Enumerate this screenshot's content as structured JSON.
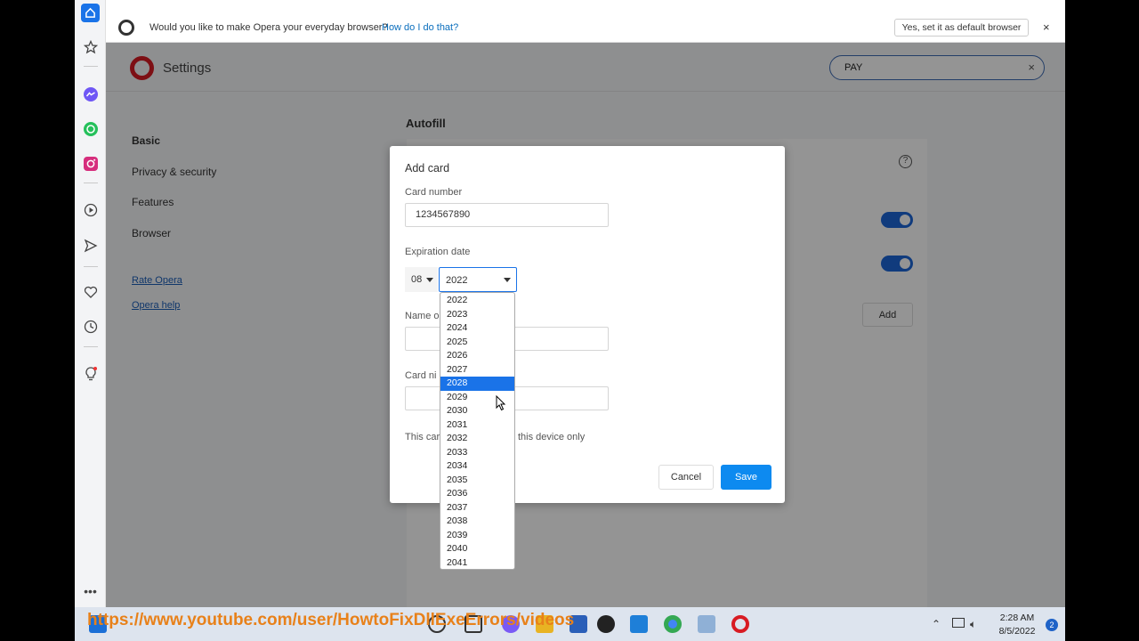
{
  "infobar": {
    "message": "Would you like to make Opera your everyday browser?",
    "link": "How do I do that?",
    "default_button": "Yes, set it as default browser",
    "close": "×"
  },
  "settings": {
    "title": "Settings",
    "search_value": "PAY",
    "search_clear": "×",
    "nav": [
      "Basic",
      "Privacy & security",
      "Features",
      "Browser"
    ],
    "links": [
      "Rate Opera",
      "Opera help"
    ],
    "section_title": "Autofill",
    "help": "?",
    "add_label": "Add"
  },
  "modal": {
    "title": "Add card",
    "card_number_label": "Card number",
    "card_number_value": "1234567890",
    "expiration_label": "Expiration date",
    "month_value": "08",
    "year_value": "2022",
    "name_label": "Name o",
    "nickname_label": "Card ni",
    "note_start": "This car",
    "note_end": "this device only",
    "cancel_label": "Cancel",
    "save_label": "Save"
  },
  "year_options": [
    "2022",
    "2023",
    "2024",
    "2025",
    "2026",
    "2027",
    "2028",
    "2029",
    "2030",
    "2031",
    "2032",
    "2033",
    "2034",
    "2035",
    "2036",
    "2037",
    "2038",
    "2039",
    "2040",
    "2041"
  ],
  "year_highlighted": "2028",
  "taskbar": {
    "watermark": "https://www.youtube.com/user/HowtoFixDllExeErrors/videos",
    "time": "2:28 AM",
    "date": "8/5/2022",
    "notifications": "2"
  },
  "colors": {
    "accent": "#1a73e8",
    "save": "#0d8af0",
    "opera_red": "#d81b23",
    "watermark": "#e8811a"
  }
}
